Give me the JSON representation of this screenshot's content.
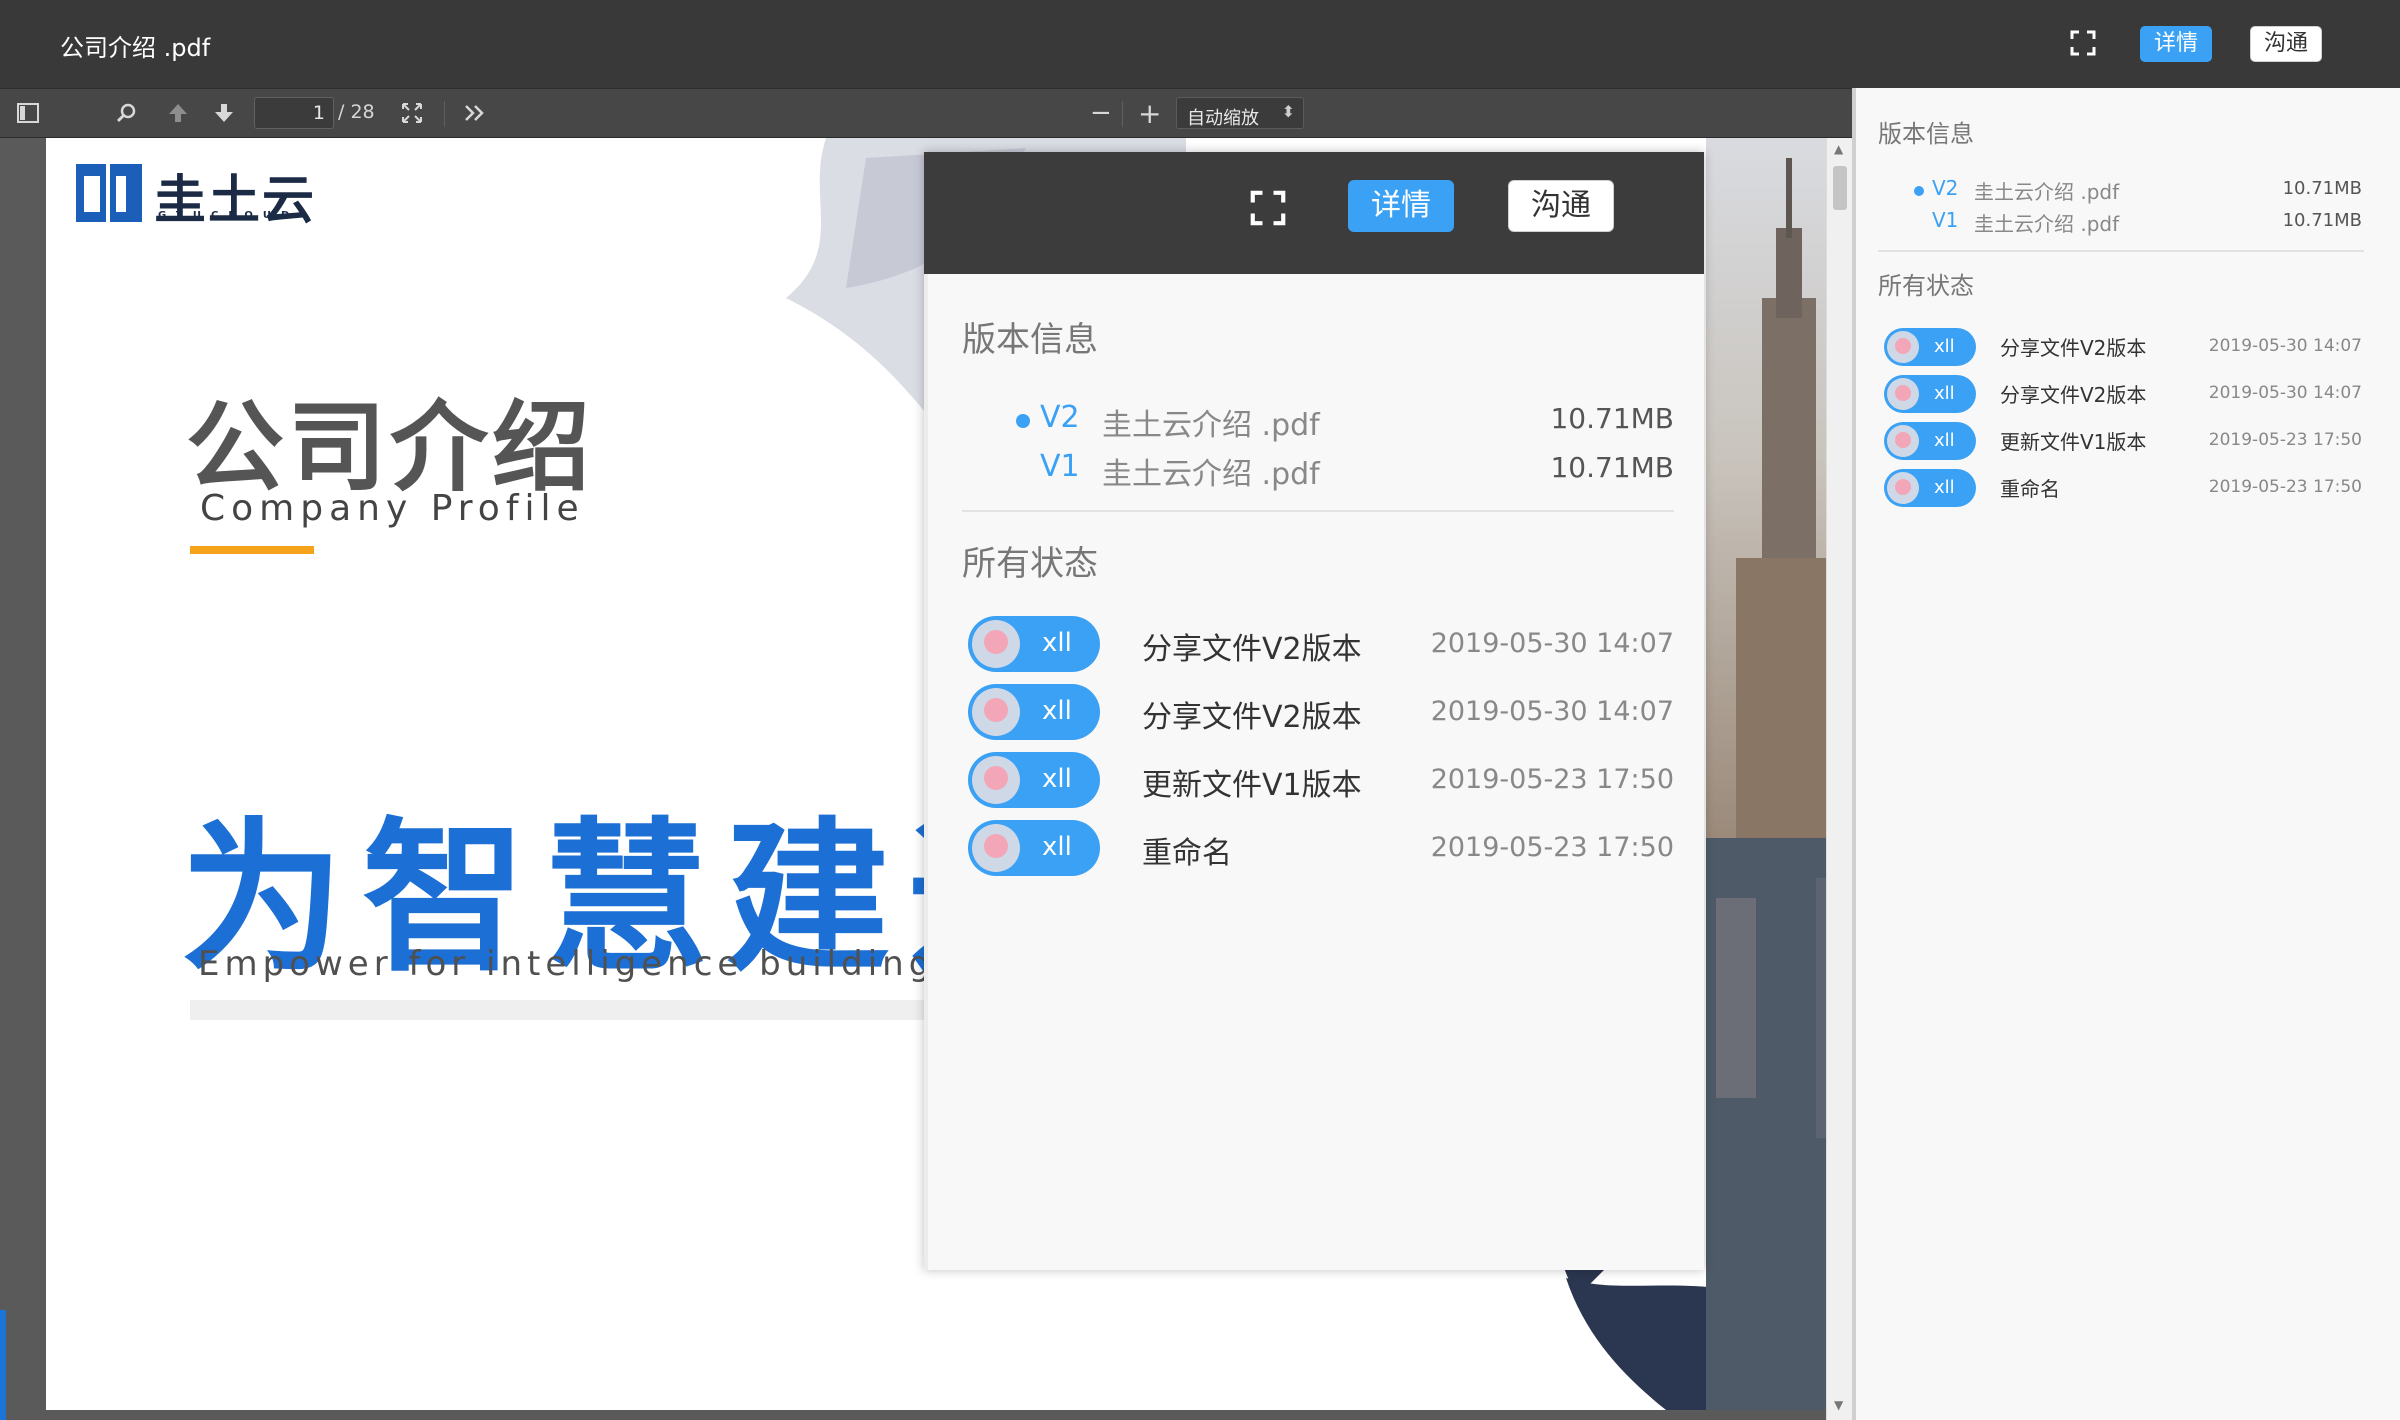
{
  "window": {
    "title": "公司介绍 .pdf",
    "fullscreen_icon": "fullscreen-icon",
    "detail_label": "详情",
    "chat_label": "沟通"
  },
  "toolbar": {
    "sidebar_icon": "sidebar-toggle-icon",
    "search_icon": "search-icon",
    "prev_icon": "arrow-up-icon",
    "next_icon": "arrow-down-icon",
    "page_current": "1",
    "page_total": "/ 28",
    "presentation_icon": "presentation-icon",
    "more_icon": "double-chevron-right-icon",
    "zoom_out": "−",
    "zoom_in": "+",
    "zoom_value": "自动缩放"
  },
  "document": {
    "logo_text": "圭土云",
    "logo_sub": "GTUCLOUD",
    "title_cn": "公司介绍",
    "title_en": "Company Profile",
    "slogan_cn": "为智慧建造",
    "slogan_en": "Empower for intelligence building"
  },
  "details": {
    "version_title": "版本信息",
    "versions": [
      {
        "tag": "V2",
        "file": "圭土云介绍 .pdf",
        "size": "10.71MB",
        "current": true
      },
      {
        "tag": "V1",
        "file": "圭土云介绍 .pdf",
        "size": "10.71MB",
        "current": false
      }
    ],
    "status_title": "所有状态",
    "activities": [
      {
        "user": "xll",
        "action": "分享文件V2版本",
        "time": "2019-05-30 14:07"
      },
      {
        "user": "xll",
        "action": "分享文件V2版本",
        "time": "2019-05-30 14:07"
      },
      {
        "user": "xll",
        "action": "更新文件V1版本",
        "time": "2019-05-23 17:50"
      },
      {
        "user": "xll",
        "action": "重命名",
        "time": "2019-05-23 17:50"
      }
    ]
  },
  "colors": {
    "accent": "#3aa1f5",
    "brand_blue": "#1c6fd4",
    "orange": "#f5a31a",
    "titlebar": "#393939"
  }
}
